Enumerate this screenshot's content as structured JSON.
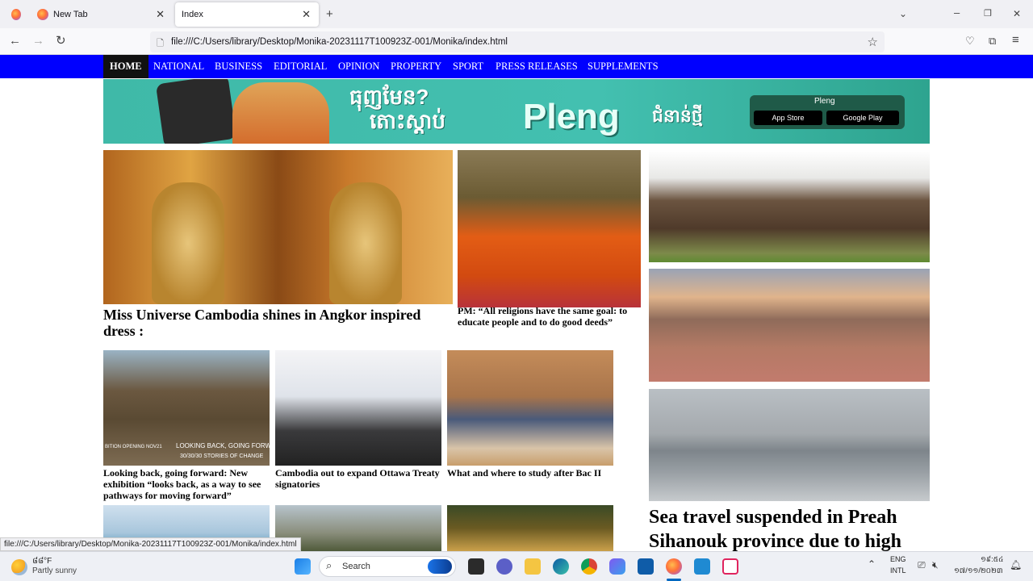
{
  "browser": {
    "tabs": [
      {
        "label": "New Tab"
      },
      {
        "label": "Index"
      }
    ],
    "url": "file:///C:/Users/library/Desktop/Monika-20231117T100923Z-001/Monika/index.html",
    "status_url": "file:///C:/Users/library/Desktop/Monika-20231117T100923Z-001/Monika/index.html"
  },
  "site": {
    "nav": [
      "HOME",
      "NATIONAL",
      "BUSINESS",
      "EDITORIAL",
      "OPINION",
      "PROPERTY",
      "SPORT",
      "PRESS RELEASES",
      "SUPPLEMENTS"
    ],
    "banner": {
      "khmer_headline": "ធុញមែន?",
      "khmer_sub": "តោះស្តាប់",
      "brand": "Pleng",
      "khmer_tail": "ជំនាន់ថ្មី",
      "app_label": "Pleng",
      "app_store": "App Store",
      "google_play": "Google Play"
    },
    "stories": {
      "main": "Miss Universe Cambodia shines in Angkor inspired dress :",
      "pm": "PM: “All religions have the same goal: to educate people and to do good deeds”",
      "looking": "Looking back, going forward: New exhibition “looks back, as a way to see pathways for moving forward”",
      "ottawa": "Cambodia out to expand Ottawa Treaty signatories",
      "study": "What and where to study after Bac II",
      "sea": "Sea travel suspended in Preah Sihanouk province due to high"
    },
    "image_text": {
      "exhibit_line1": "LOOKING BACK, GOING FORWA",
      "exhibit_line2": "30/30/30 STORIES OF CHANGE",
      "exhibit_small": "BITION OPENING NOV21"
    }
  },
  "taskbar": {
    "weather_temp": "៨៨°F",
    "weather_desc": "Partly sunny",
    "search_placeholder": "Search",
    "lang1": "ENG",
    "lang2": "INTL",
    "time": "១៩:៥៤",
    "date": "១៧/១១/២០២៣"
  }
}
